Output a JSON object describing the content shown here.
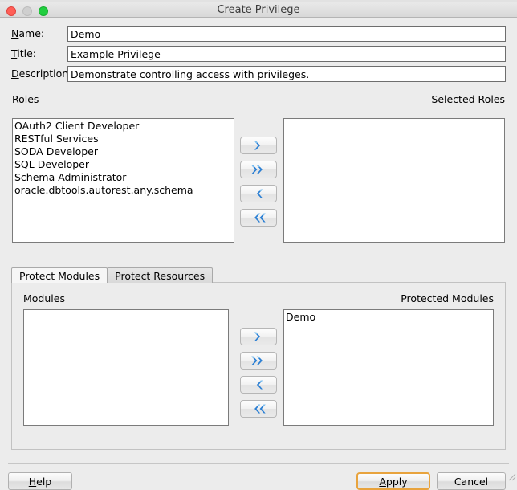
{
  "window": {
    "title": "Create Privilege",
    "controls": [
      {
        "name": "close",
        "color": "#ff5f57"
      },
      {
        "name": "minimize",
        "color": "#cfcfcf"
      },
      {
        "name": "zoom",
        "color": "#21ce3f"
      }
    ]
  },
  "form": {
    "fields": [
      {
        "label": "Name:",
        "mnemonic": "N",
        "rest": "ame:",
        "value": "Demo",
        "placeholder": ""
      },
      {
        "label": "Title:",
        "mnemonic": "T",
        "rest": "itle:",
        "value": "Example Privilege",
        "placeholder": ""
      },
      {
        "label": "Description:",
        "mnemonic": "D",
        "rest": "escription:",
        "value": "Demonstrate controlling access with privileges.",
        "placeholder": ""
      }
    ]
  },
  "roles_section": {
    "available_label": "Roles",
    "selected_label": "Selected Roles",
    "available_items": [
      "OAuth2 Client Developer",
      "RESTful Services",
      "SODA Developer",
      "SQL Developer",
      "Schema Administrator",
      "oracle.dbtools.autorest.any.schema"
    ],
    "selected_items": [],
    "transfer_buttons": [
      {
        "name": "move-right",
        "icon": "chevron-right-icon",
        "tooltip": "Move selected right"
      },
      {
        "name": "move-all-right",
        "icon": "chevron-double-right-icon",
        "tooltip": "Move all right"
      },
      {
        "name": "move-left",
        "icon": "chevron-left-icon",
        "tooltip": "Move selected left"
      },
      {
        "name": "move-all-left",
        "icon": "chevron-double-left-icon",
        "tooltip": "Move all left"
      }
    ]
  },
  "tabs": {
    "items": [
      {
        "label": "Protect Modules",
        "active": true
      },
      {
        "label": "Protect Resources",
        "active": false
      }
    ]
  },
  "modules_section": {
    "available_label": "Modules",
    "selected_label": "Protected Modules",
    "available_items": [],
    "selected_items": [
      "Demo"
    ],
    "transfer_buttons": [
      {
        "name": "move-right",
        "icon": "chevron-right-icon",
        "tooltip": "Move selected right"
      },
      {
        "name": "move-all-right",
        "icon": "chevron-double-right-icon",
        "tooltip": "Move all right"
      },
      {
        "name": "move-left",
        "icon": "chevron-left-icon",
        "tooltip": "Move selected left"
      },
      {
        "name": "move-all-left",
        "icon": "chevron-double-left-icon",
        "tooltip": "Move all left"
      }
    ]
  },
  "footer": {
    "help_label": "Help",
    "help_mnemonic": "H",
    "help_pre": "",
    "help_post": "elp",
    "apply_label": "Apply",
    "apply_mnemonic": "A",
    "apply_post": "pply",
    "cancel_label": "Cancel",
    "focused_button": "Apply"
  },
  "colors": {
    "window_background": "#ececec",
    "field_background": "#ffffff",
    "field_border": "#6e6e6e",
    "focus_ring": "#e8a33d",
    "chevron_blue": "#2a7fd4",
    "titlebar_text": "#3a3a3a"
  }
}
